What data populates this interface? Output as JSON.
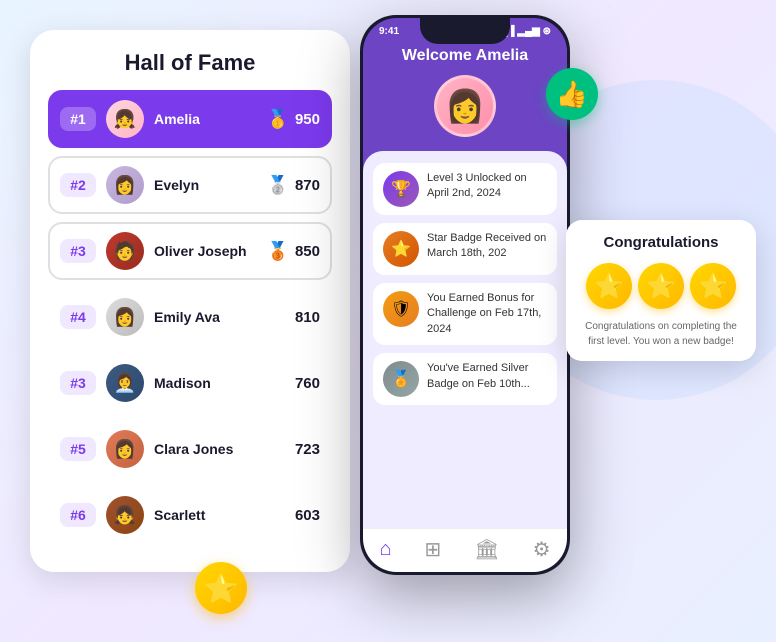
{
  "background": {
    "color": "#e8f0ff"
  },
  "hall_of_fame": {
    "title": "Hall of Fame",
    "rows": [
      {
        "rank": "#1",
        "name": "Amelia",
        "score": "950",
        "medal": "🥇",
        "is_highlighted": true
      },
      {
        "rank": "#2",
        "name": "Evelyn",
        "score": "870",
        "medal": "🥈",
        "is_highlighted": false
      },
      {
        "rank": "#3",
        "name": "Oliver Joseph",
        "score": "850",
        "medal": "🥉",
        "is_highlighted": false
      },
      {
        "rank": "#4",
        "name": "Emily Ava",
        "score": "810",
        "medal": "",
        "is_highlighted": false
      },
      {
        "rank": "#3",
        "name": "Madison",
        "score": "760",
        "medal": "",
        "is_highlighted": false
      },
      {
        "rank": "#5",
        "name": "Clara Jones",
        "score": "723",
        "medal": "",
        "is_highlighted": false
      },
      {
        "rank": "#6",
        "name": "Scarlett",
        "score": "603",
        "medal": "",
        "is_highlighted": false
      }
    ]
  },
  "phone": {
    "status_time": "9:41",
    "welcome_text": "Welcome Amelia",
    "activities": [
      {
        "text": "Level 3 Unlocked on April 2nd, 2024",
        "icon_type": "purple"
      },
      {
        "text": "Star Badge Received on March 18th, 202",
        "icon_type": "orange"
      },
      {
        "text": "You Earned Bonus for Challenge on Feb 17th, 2024",
        "icon_type": "gold"
      },
      {
        "text": "You've Earned Silver Badge on Feb 10th...",
        "icon_type": "silver"
      }
    ]
  },
  "congrats": {
    "title": "Congratulations",
    "text": "Congratulations on completing the first level. You won a new badge!",
    "stars_count": 3
  },
  "decorations": {
    "thumbs_up": "👍",
    "star": "⭐"
  }
}
